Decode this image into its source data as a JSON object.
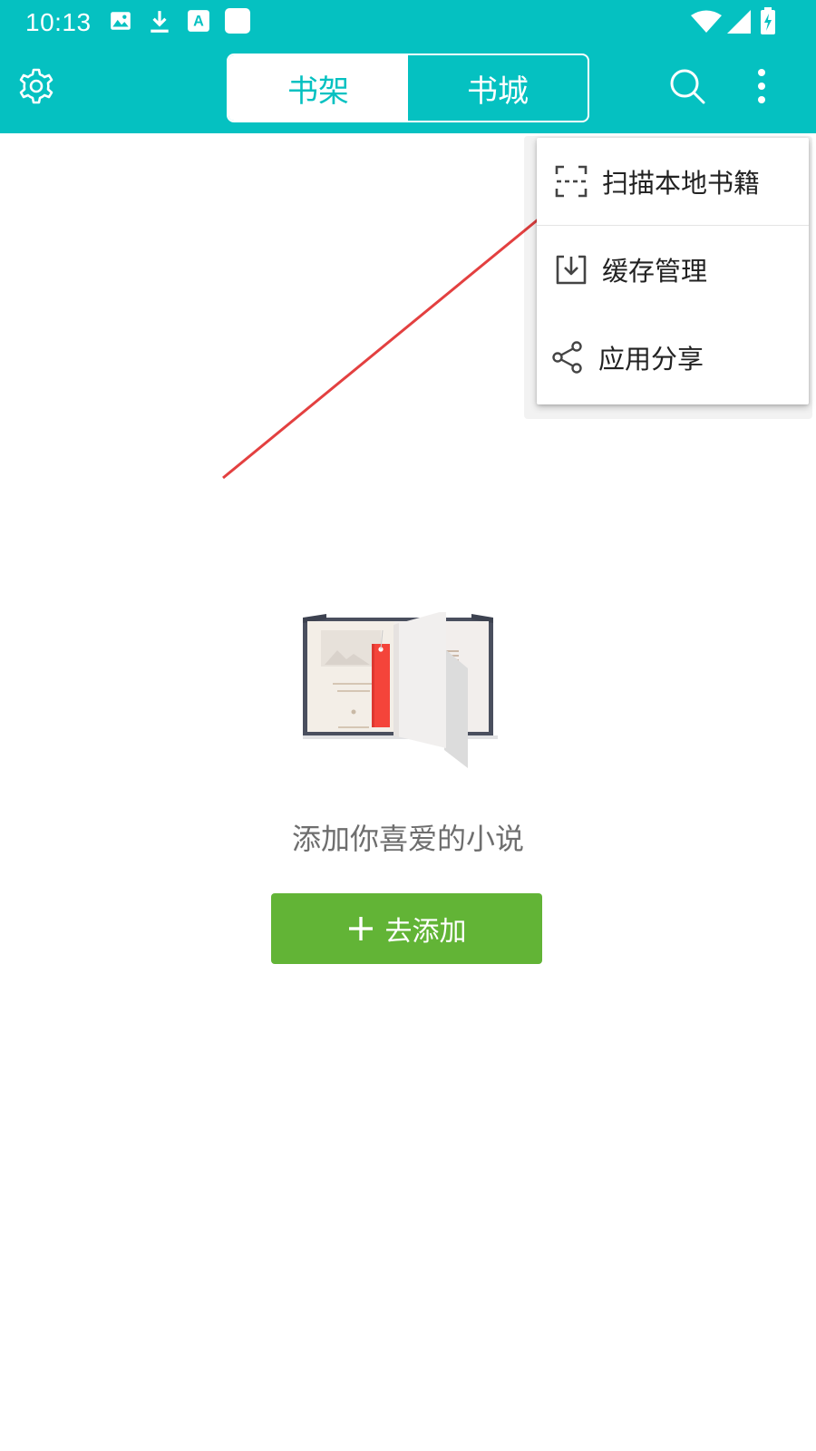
{
  "status_bar": {
    "time": "10:13",
    "icons": [
      "image-icon",
      "download-icon",
      "text-a-icon",
      "blank-square-icon",
      "wifi-icon",
      "signal-icon",
      "battery-charging-icon"
    ]
  },
  "app_bar": {
    "left_icon": "gear-icon",
    "tabs": [
      {
        "label": "书架",
        "active": true
      },
      {
        "label": "书城",
        "active": false
      }
    ],
    "right_icons": [
      "search-icon",
      "more-vert-icon"
    ]
  },
  "menu": {
    "items": [
      {
        "label": "扫描本地书籍",
        "icon": "scan-icon"
      },
      {
        "label": "缓存管理",
        "icon": "download-tray-icon"
      },
      {
        "label": "应用分享",
        "icon": "share-icon"
      }
    ]
  },
  "empty_state": {
    "message": "添加你喜爱的小说",
    "button_label": "去添加",
    "button_icon": "plus-icon"
  },
  "colors": {
    "primary": "#05c1c1",
    "button_green": "#62b436",
    "annotation_arrow": "#e34040"
  }
}
